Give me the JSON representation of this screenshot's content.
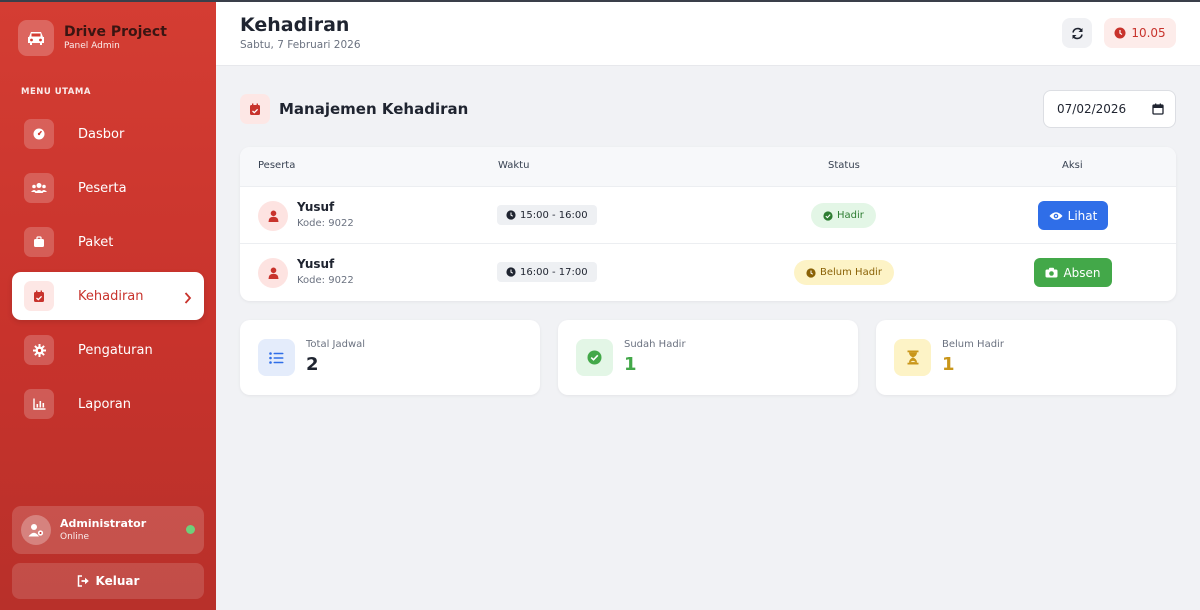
{
  "brand": {
    "title": "Drive Project",
    "subtitle": "Panel Admin"
  },
  "sidebar": {
    "section_label": "MENU UTAMA",
    "items": [
      {
        "label": "Dasbor",
        "icon": "gauge-icon"
      },
      {
        "label": "Peserta",
        "icon": "users-icon"
      },
      {
        "label": "Paket",
        "icon": "briefcase-icon"
      },
      {
        "label": "Kehadiran",
        "icon": "calendar-check-icon",
        "active": true
      },
      {
        "label": "Pengaturan",
        "icon": "gear-icon"
      },
      {
        "label": "Laporan",
        "icon": "chart-icon"
      }
    ],
    "user": {
      "name": "Administrator",
      "status": "Online"
    },
    "logout_label": "Keluar"
  },
  "header": {
    "title": "Kehadiran",
    "date": "Sabtu, 7 Februari 2026",
    "clock": "10.05"
  },
  "section": {
    "title": "Manajemen Kehadiran",
    "date_value": "07/02/2026"
  },
  "table": {
    "columns": [
      "Peserta",
      "Waktu",
      "Status",
      "Aksi"
    ],
    "rows": [
      {
        "name": "Yusuf",
        "code": "Kode: 9022",
        "time": "15:00 - 16:00",
        "status": "Hadir",
        "action": "Lihat"
      },
      {
        "name": "Yusuf",
        "code": "Kode: 9022",
        "time": "16:00 - 17:00",
        "status": "Belum Hadir",
        "action": "Absen"
      }
    ]
  },
  "stats": [
    {
      "label": "Total Jadwal",
      "value": "2",
      "color": "#1f2430"
    },
    {
      "label": "Sudah Hadir",
      "value": "1",
      "color": "#43a849"
    },
    {
      "label": "Belum Hadir",
      "value": "1",
      "color": "#c9961a"
    }
  ],
  "colors": {
    "primary": "#c8332c",
    "blue": "#2f6ee8",
    "green": "#43a849",
    "yellow": "#c9961a"
  }
}
